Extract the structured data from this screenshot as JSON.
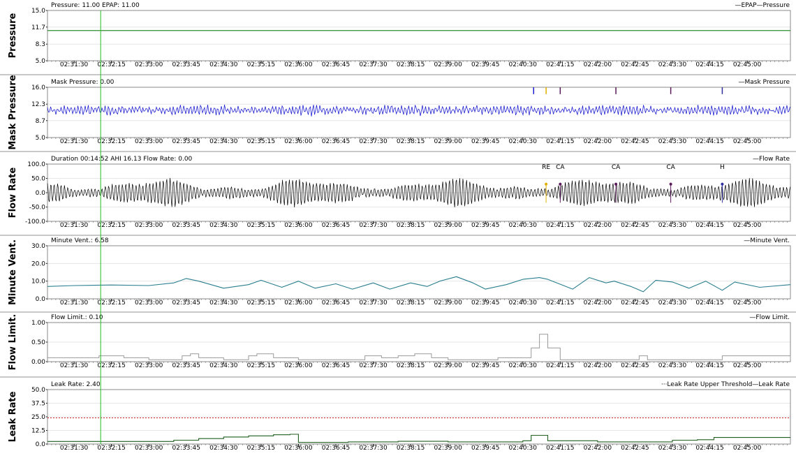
{
  "colors": {
    "pressure_line": "#2e8b2e",
    "mask_pressure": "#1f1fd0",
    "flow_rate": "#000000",
    "minute_vent": "#2a7f8f",
    "flow_limit": "#9a9a9a",
    "leak_rate": "#1f5f1f",
    "leak_threshold": "#cc2222",
    "cursor": "#22bb22",
    "event_re": "#e0b000",
    "event_ca": "#5a1a5a",
    "event_h": "#3030a0"
  },
  "time_axis": {
    "ticks": [
      "02:31:30",
      "02:32:15",
      "02:33:00",
      "02:33:45",
      "02:34:30",
      "02:35:15",
      "02:36:00",
      "02:36:45",
      "02:37:30",
      "02:38:15",
      "02:39:00",
      "02:39:45",
      "02:40:30",
      "02:41:15",
      "02:42:00",
      "02:42:45",
      "02:43:30",
      "02:44:15",
      "02:45:00"
    ],
    "start": "02:30:58",
    "end": "02:45:52",
    "cursor": "02:32:02"
  },
  "panels": [
    {
      "id": "pressure",
      "ylabel": "Pressure",
      "header": "Pressure: 11.00 EPAP: 11.00",
      "legend": "—EPAP—Pressure",
      "yticks": [
        "15.0",
        "11.7",
        "8.3",
        "5.0"
      ],
      "ylim": [
        5.0,
        15.0
      ],
      "show_time_ticks": true
    },
    {
      "id": "mask_pressure",
      "ylabel": "Mask Pressure",
      "header": "Mask Pressure: 0.00",
      "legend": "—Mask Pressure",
      "yticks": [
        "16.0",
        "12.3",
        "8.7",
        "5.0"
      ],
      "ylim": [
        5.0,
        16.0
      ],
      "show_time_ticks": true
    },
    {
      "id": "flow_rate",
      "ylabel": "Flow Rate",
      "header": "Duration 00:14:52 AHI 16.13 Flow Rate: 0.00",
      "legend": "—Flow Rate",
      "yticks": [
        "100.0",
        "50.0",
        "0.0",
        "-50.0",
        "-100.0"
      ],
      "ylim": [
        -100.0,
        100.0
      ],
      "show_time_ticks": true
    },
    {
      "id": "minute_vent",
      "ylabel": "Minute Vent.",
      "header": "Minute Vent.: 6.58",
      "legend": "—Minute Vent.",
      "yticks": [
        "30.0",
        "20.0",
        "10.0",
        "0.0"
      ],
      "ylim": [
        0.0,
        30.0
      ],
      "show_time_ticks": true
    },
    {
      "id": "flow_limit",
      "ylabel": "Flow Limit.",
      "header": "Flow Limit.: 0.10",
      "legend": "—Flow Limit.",
      "yticks": [
        "1.00",
        "0.50",
        "0.00"
      ],
      "ylim": [
        0.0,
        1.0
      ],
      "show_time_ticks": true
    },
    {
      "id": "leak_rate",
      "ylabel": "Leak Rate",
      "header": "Leak Rate: 2.40",
      "legend": "···Leak Rate Upper Threshold—Leak Rate",
      "yticks": [
        "50.0",
        "37.5",
        "25.0",
        "12.5",
        "0.0"
      ],
      "ylim": [
        0.0,
        50.0
      ],
      "show_time_ticks": true
    }
  ],
  "events": [
    {
      "label": "RE",
      "time": "02:40:58",
      "type": "re"
    },
    {
      "label": "CA",
      "time": "02:41:15",
      "type": "ca"
    },
    {
      "label": "CA",
      "time": "02:42:22",
      "type": "ca"
    },
    {
      "label": "CA",
      "time": "02:43:28",
      "type": "ca"
    },
    {
      "label": "H",
      "time": "02:44:30",
      "type": "h"
    }
  ],
  "chart_data": [
    {
      "type": "line",
      "title": "Pressure: 11.00 EPAP: 11.00",
      "ylabel": "Pressure",
      "ylim": [
        5.0,
        15.0
      ],
      "series": [
        {
          "name": "EPAP",
          "x": [
            "02:30:58",
            "02:45:52"
          ],
          "values": [
            11.0,
            11.0
          ]
        },
        {
          "name": "Pressure",
          "x": [
            "02:30:58",
            "02:45:52"
          ],
          "values": [
            11.0,
            11.0
          ]
        }
      ]
    },
    {
      "type": "line",
      "title": "Mask Pressure: 0.00",
      "ylabel": "Mask Pressure",
      "ylim": [
        5.0,
        16.0
      ],
      "series": [
        {
          "name": "Mask Pressure",
          "description_level": 11.0
        }
      ]
    },
    {
      "type": "line",
      "title": "Duration 00:14:52 AHI 16.13 Flow Rate: 0.00",
      "ylabel": "Flow Rate",
      "ylim": [
        -100.0,
        100.0
      ],
      "series": [
        {
          "name": "Flow Rate",
          "typical_amplitude": 35
        }
      ]
    },
    {
      "type": "line",
      "title": "Minute Vent.: 6.58",
      "ylabel": "Minute Vent.",
      "ylim": [
        0.0,
        30.0
      ],
      "series": [
        {
          "name": "Minute Vent.",
          "x": [
            "02:30:58",
            "02:31:30",
            "02:32:15",
            "02:33:00",
            "02:33:30",
            "02:33:45",
            "02:34:00",
            "02:34:30",
            "02:35:00",
            "02:35:15",
            "02:35:40",
            "02:36:00",
            "02:36:20",
            "02:36:45",
            "02:37:05",
            "02:37:30",
            "02:37:50",
            "02:38:15",
            "02:38:35",
            "02:38:50",
            "02:39:10",
            "02:39:30",
            "02:39:45",
            "02:40:10",
            "02:40:30",
            "02:40:50",
            "02:41:00",
            "02:41:30",
            "02:41:50",
            "02:42:10",
            "02:42:20",
            "02:42:40",
            "02:42:55",
            "02:43:10",
            "02:43:30",
            "02:43:50",
            "02:44:10",
            "02:44:30",
            "02:44:45",
            "02:45:15",
            "02:45:52"
          ],
          "values": [
            7,
            7.5,
            7.8,
            7.5,
            9,
            11.5,
            10,
            6,
            8,
            10.5,
            6.5,
            10,
            6,
            8.5,
            5.5,
            9,
            5.5,
            9,
            7,
            10,
            12.5,
            9,
            5.5,
            8,
            11,
            12,
            11,
            5.5,
            12,
            9,
            10,
            7,
            4,
            10.5,
            9.5,
            6,
            10,
            4.8,
            9.5,
            6.5,
            8
          ]
        }
      ]
    },
    {
      "type": "line",
      "title": "Flow Limit.: 0.10",
      "ylabel": "Flow Limit.",
      "ylim": [
        0.0,
        1.0
      ],
      "series": [
        {
          "name": "Flow Limit.",
          "x": [
            "02:30:58",
            "02:31:40",
            "02:32:00",
            "02:32:30",
            "02:33:00",
            "02:33:40",
            "02:33:50",
            "02:34:00",
            "02:34:30",
            "02:35:00",
            "02:35:10",
            "02:35:30",
            "02:36:00",
            "02:37:00",
            "02:37:20",
            "02:37:40",
            "02:38:00",
            "02:38:20",
            "02:38:40",
            "02:39:00",
            "02:40:00",
            "02:40:40",
            "02:40:50",
            "02:41:00",
            "02:41:15",
            "02:42:40",
            "02:42:50",
            "02:43:00",
            "02:44:20",
            "02:44:30",
            "02:45:52"
          ],
          "values": [
            0.1,
            0.1,
            0.15,
            0.1,
            0.05,
            0.15,
            0.2,
            0.1,
            0.05,
            0.15,
            0.2,
            0.1,
            0.05,
            0.05,
            0.15,
            0.1,
            0.15,
            0.2,
            0.1,
            0.05,
            0.1,
            0.35,
            0.7,
            0.35,
            0.05,
            0.05,
            0.15,
            0.05,
            0.05,
            0.15,
            0.05
          ]
        }
      ]
    },
    {
      "type": "line",
      "title": "Leak Rate: 2.40",
      "ylabel": "Leak Rate",
      "ylim": [
        0.0,
        50.0
      ],
      "series": [
        {
          "name": "Leak Rate Upper Threshold",
          "x": [
            "02:30:58",
            "02:45:52"
          ],
          "values": [
            24,
            24
          ]
        },
        {
          "name": "Leak Rate",
          "x": [
            "02:30:58",
            "02:33:00",
            "02:33:30",
            "02:34:00",
            "02:34:30",
            "02:35:00",
            "02:35:30",
            "02:35:50",
            "02:36:00",
            "02:37:00",
            "02:38:00",
            "02:39:00",
            "02:40:00",
            "02:40:30",
            "02:40:40",
            "02:41:00",
            "02:42:00",
            "02:43:00",
            "02:43:30",
            "02:44:00",
            "02:44:20",
            "02:45:52"
          ],
          "values": [
            2.4,
            2.4,
            3.5,
            5,
            6.5,
            7.5,
            8.5,
            9,
            1.5,
            2,
            2.5,
            2,
            2,
            3,
            8,
            3,
            2,
            2,
            3.5,
            4,
            6,
            6
          ]
        }
      ]
    }
  ]
}
